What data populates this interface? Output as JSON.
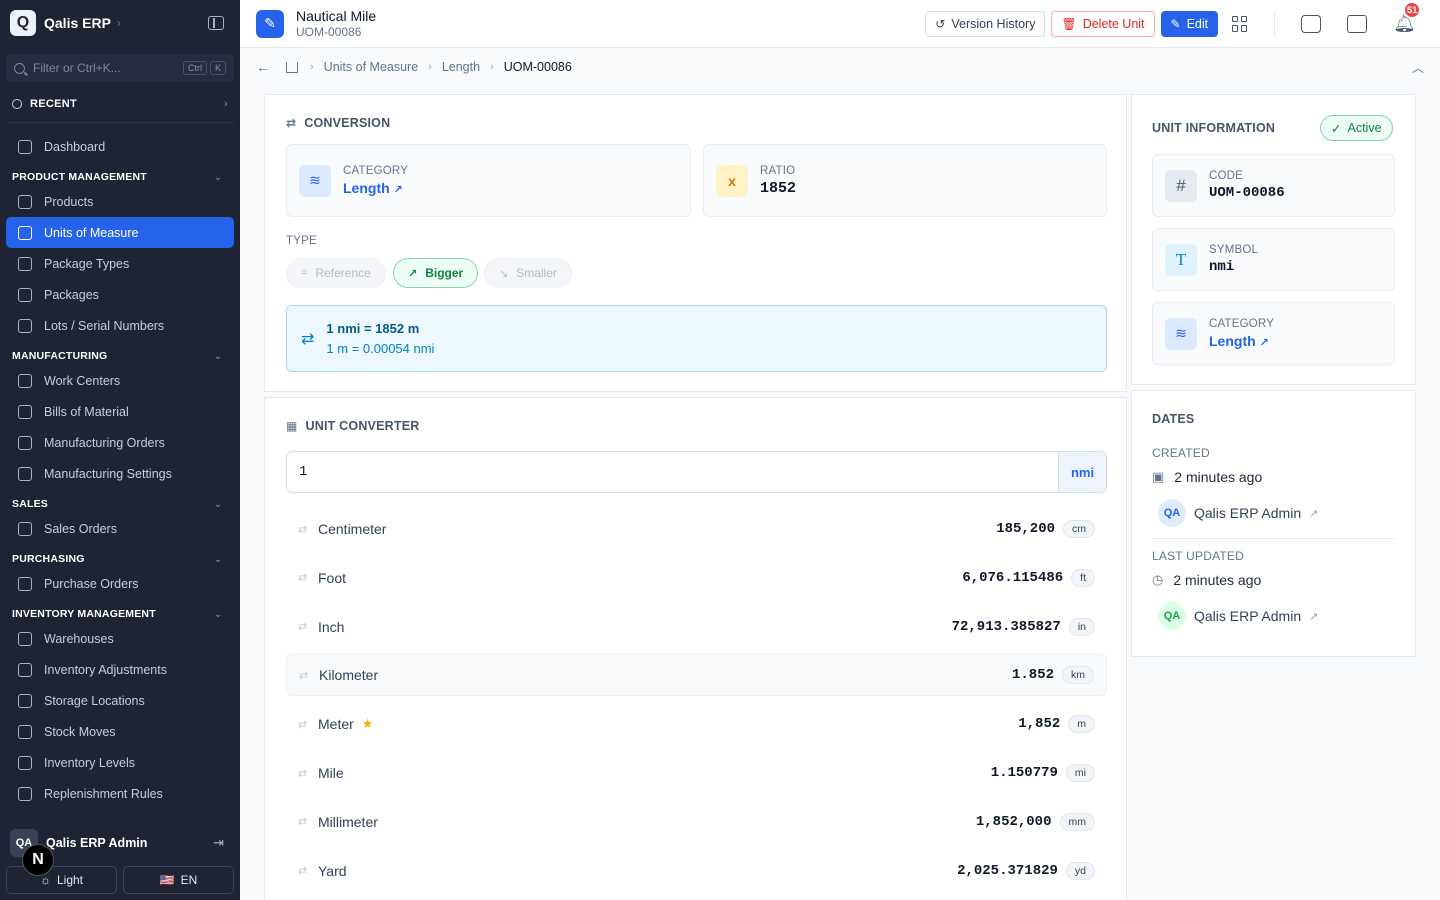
{
  "app": {
    "logo_letter": "Q",
    "name": "Qalis ERP",
    "chev": "›"
  },
  "sidebar": {
    "filter_placeholder": "Filter or Ctrl+K...",
    "kbd1": "Ctrl",
    "kbd2": "K",
    "recent": "RECENT",
    "dashboard": "Dashboard",
    "sections": [
      {
        "title": "PRODUCT MANAGEMENT",
        "items": [
          "Products",
          "Units of Measure",
          "Package Types",
          "Packages",
          "Lots / Serial Numbers"
        ]
      },
      {
        "title": "MANUFACTURING",
        "items": [
          "Work Centers",
          "Bills of Material",
          "Manufacturing Orders",
          "Manufacturing Settings"
        ]
      },
      {
        "title": "SALES",
        "items": [
          "Sales Orders"
        ]
      },
      {
        "title": "PURCHASING",
        "items": [
          "Purchase Orders"
        ]
      },
      {
        "title": "INVENTORY MANAGEMENT",
        "items": [
          "Warehouses",
          "Inventory Adjustments",
          "Storage Locations",
          "Stock Moves",
          "Inventory Levels",
          "Replenishment Rules"
        ]
      }
    ],
    "user_initials": "QA",
    "user_name": "Qalis ERP Admin",
    "theme_label": "Light",
    "lang_label": "EN",
    "flag": "🇺🇸",
    "n_badge": "N"
  },
  "header": {
    "title": "Nautical Mile",
    "code": "UOM-00086",
    "version_history": "Version History",
    "delete": "Delete Unit",
    "edit": "Edit",
    "notif_count": "51"
  },
  "breadcrumb": [
    "Units of Measure",
    "Length",
    "UOM-00086"
  ],
  "conversion": {
    "title": "CONVERSION",
    "category_label": "CATEGORY",
    "category_value": "Length",
    "ratio_label": "RATIO",
    "ratio_icon": "x",
    "ratio_value": "1852",
    "type_label": "TYPE",
    "types": [
      "Reference",
      "Bigger",
      "Smaller"
    ],
    "active_type": "Bigger",
    "formula_1": "1 nmi = 1852 m",
    "formula_2": "1 m = 0.00054 nmi"
  },
  "converter": {
    "title": "UNIT CONVERTER",
    "input_value": "1",
    "input_unit": "nmi",
    "rows": [
      {
        "name": "Centimeter",
        "value": "185,200",
        "unit": "cm"
      },
      {
        "name": "Foot",
        "value": "6,076.115486",
        "unit": "ft"
      },
      {
        "name": "Inch",
        "value": "72,913.385827",
        "unit": "in"
      },
      {
        "name": "Kilometer",
        "value": "1.852",
        "unit": "km"
      },
      {
        "name": "Meter",
        "value": "1,852",
        "unit": "m"
      },
      {
        "name": "Mile",
        "value": "1.150779",
        "unit": "mi"
      },
      {
        "name": "Millimeter",
        "value": "1,852,000",
        "unit": "mm"
      },
      {
        "name": "Yard",
        "value": "2,025.371829",
        "unit": "yd"
      }
    ]
  },
  "unit_info": {
    "title": "UNIT INFORMATION",
    "status": "Active",
    "code_label": "CODE",
    "code_value": "UOM-00086",
    "symbol_label": "SYMBOL",
    "symbol_value": "nmi",
    "category_label": "CATEGORY",
    "category_value": "Length"
  },
  "dates": {
    "title": "DATES",
    "created_label": "CREATED",
    "created_value": "2 minutes ago",
    "created_by_initials": "QA",
    "created_by": "Qalis ERP Admin",
    "updated_label": "LAST UPDATED",
    "updated_value": "2 minutes ago",
    "updated_by_initials": "QA",
    "updated_by": "Qalis ERP Admin"
  }
}
